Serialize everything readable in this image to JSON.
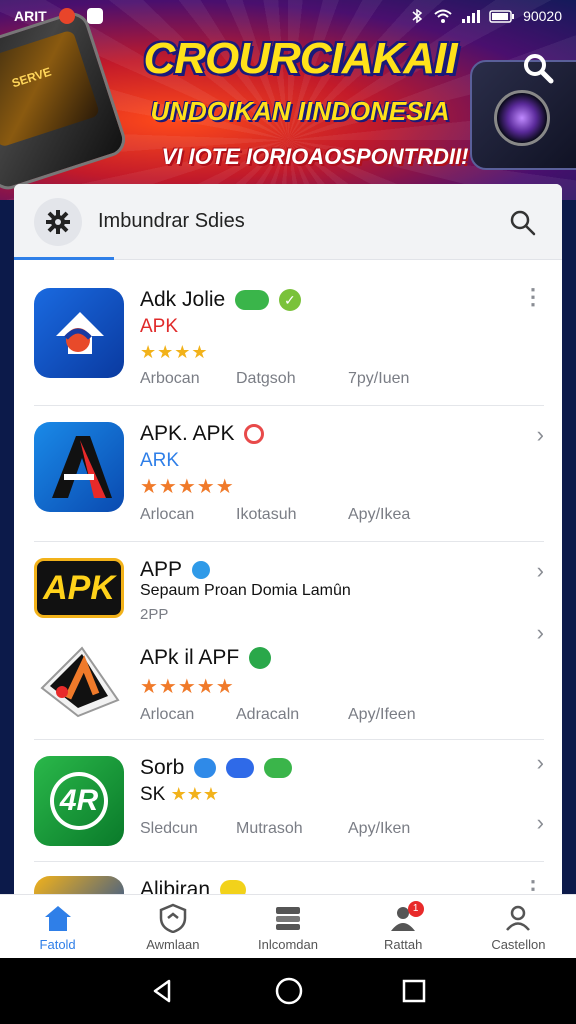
{
  "status_bar": {
    "carrier": "ARIT",
    "time": "90020"
  },
  "banner": {
    "phone_text": "SERVE",
    "title": "CROURCIAKAII",
    "subtitle": "UNDOIKAN IINDONESIA",
    "tagline": "VI IOTE IORIOAOSPONTRDII!"
  },
  "search": {
    "placeholder": "Imbundrar Sdies"
  },
  "apps": [
    {
      "name": "Adk Jolie",
      "sub": "APK",
      "meta": [
        "Arbocan",
        "Datgsoh",
        "7py/Iuen"
      ]
    },
    {
      "name": "APK. APK",
      "sub": "ARK",
      "meta": [
        "Arlocan",
        "Ikotasuh",
        "Apy/Ikea"
      ]
    },
    {
      "name": "APP",
      "sub": "Sepaum Proan Domia Lamûn",
      "sub2": "2PP",
      "icon_text": "APK"
    },
    {
      "name": "APk il APF",
      "meta": [
        "Arlocan",
        "Adracaln",
        "Apy/Ifeen"
      ]
    },
    {
      "name": "Sorb",
      "sub": "SK",
      "icon_text": "4R",
      "meta": [
        "Sledcun",
        "Mutrasoh",
        "Apy/Iken"
      ]
    },
    {
      "name": "Alibiran"
    }
  ],
  "bottom_nav": [
    {
      "label": "Fatold",
      "icon": "home-icon"
    },
    {
      "label": "Awmlaan",
      "icon": "shield-icon"
    },
    {
      "label": "Inlcomdan",
      "icon": "storage-icon"
    },
    {
      "label": "Rattah",
      "icon": "person-icon",
      "badge": "1"
    },
    {
      "label": "Castellon",
      "icon": "profile-icon"
    }
  ],
  "colors": {
    "accent": "#2f7fe8",
    "star_yellow": "#f2b21a",
    "star_orange": "#f07a2a"
  }
}
